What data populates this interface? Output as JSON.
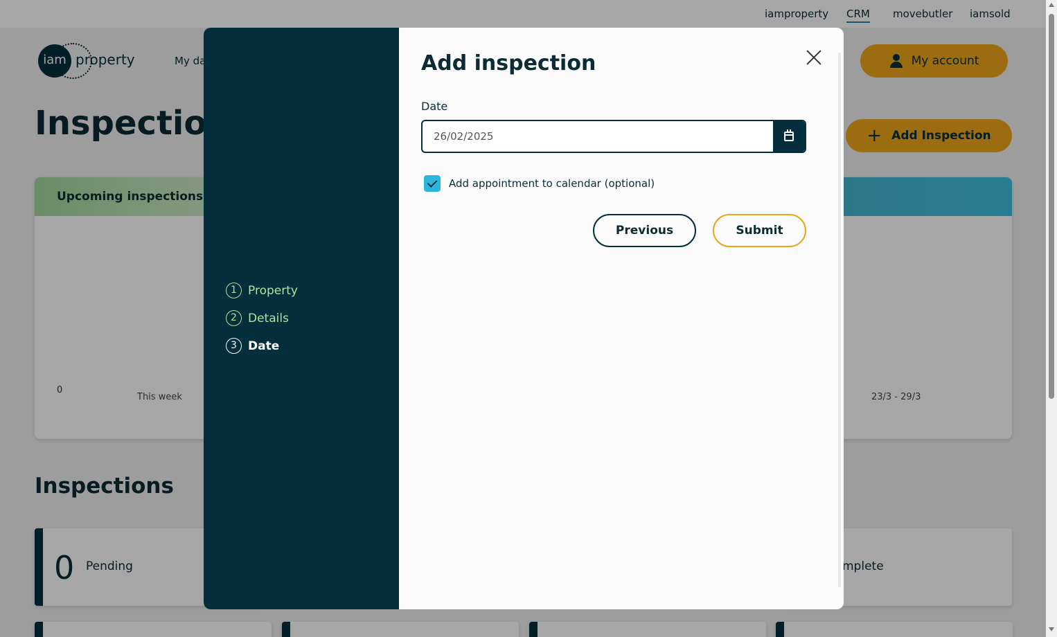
{
  "topbar": {
    "links": [
      {
        "label": "iamproperty"
      },
      {
        "label": "CRM"
      },
      {
        "label": "movebutler"
      },
      {
        "label": "iamsold"
      }
    ]
  },
  "header": {
    "logo_circle_text": "iam",
    "logo_text": "property",
    "nav_partial": "My da",
    "account_label": "My account",
    "account_icon": "person-icon"
  },
  "page": {
    "title": "Inspections",
    "add_button_label": "Add Inspection",
    "add_button_icon": "plus-icon"
  },
  "chart_cards": {
    "left": {
      "title": "Upcoming inspections",
      "axis_zero": "0",
      "x_label": "This week"
    },
    "right": {
      "x_label": "23/3 - 29/3"
    }
  },
  "inspections": {
    "title": "Inspections",
    "pending": {
      "count": "0",
      "label": "Pending"
    },
    "complete_partial": "mplete"
  },
  "modal": {
    "steps": [
      {
        "num": "1",
        "label": "Property"
      },
      {
        "num": "2",
        "label": "Details"
      },
      {
        "num": "3",
        "label": "Date"
      }
    ],
    "title": "Add inspection",
    "date_label": "Date",
    "date_value": "26/02/2025",
    "calendar_icon": "calendar-icon",
    "checkbox_label": "Add appointment to calendar (optional)",
    "checkbox_checked": true,
    "previous_label": "Previous",
    "submit_label": "Submit"
  },
  "colors": {
    "brand_dark": "#042e3c",
    "accent_orange": "#f0a81a",
    "step_done": "#a8e6a3",
    "checkbox": "#2bb6e0"
  }
}
